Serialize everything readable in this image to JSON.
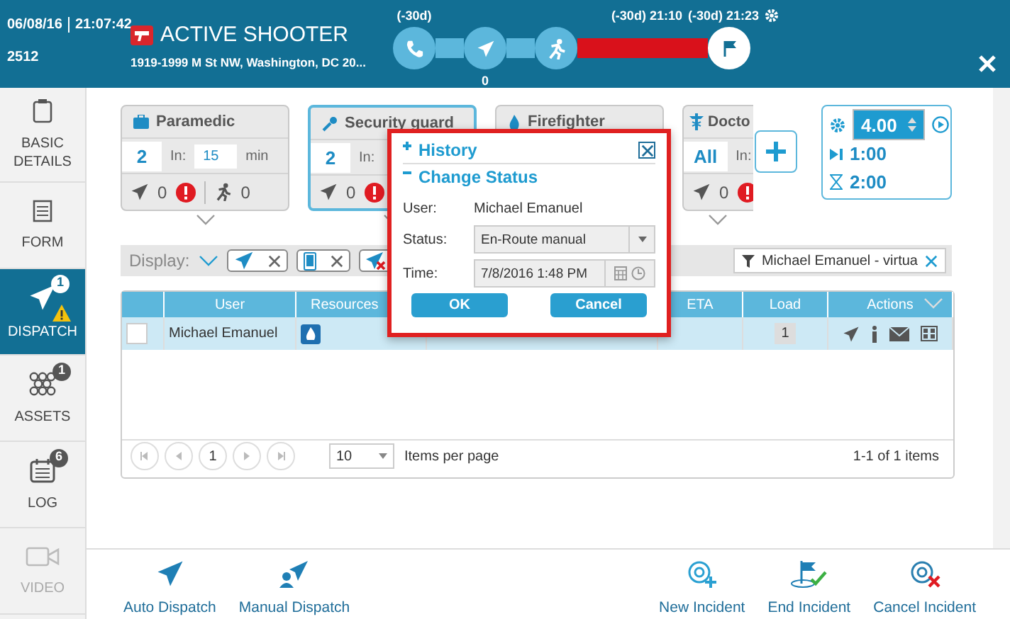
{
  "header": {
    "date": "06/08/16",
    "time": "21:07:42",
    "id": "2512",
    "title": "ACTIVE SHOOTER",
    "address": "1919-1999 M St NW, Washington, DC 20...",
    "timeline": {
      "start_label": "(-30d)",
      "dispatched_count": "0",
      "bar_label": "(-30d) 21:10",
      "end_label": "(-30d) 21:23"
    }
  },
  "sidebar": {
    "items": [
      {
        "label": "BASIC DETAILS",
        "selected": false,
        "disabled": false
      },
      {
        "label": "FORM",
        "selected": false,
        "disabled": false
      },
      {
        "label": "DISPATCH",
        "badge": "1",
        "warning": true,
        "selected": true,
        "disabled": false
      },
      {
        "label": "ASSETS",
        "badge": "1",
        "selected": false,
        "disabled": false
      },
      {
        "label": "LOG",
        "badge": "6",
        "selected": false,
        "disabled": false
      },
      {
        "label": "VIDEO",
        "selected": false,
        "disabled": true
      }
    ]
  },
  "cards": [
    {
      "title": "Paramedic",
      "count": "2",
      "in_label": "In:",
      "in_value": "15",
      "unit": "min",
      "dispatched": "0",
      "alert": true,
      "on_scene": "0",
      "selected": false
    },
    {
      "title": "Security guard",
      "count": "2",
      "in_label": "In:",
      "dispatched": "0",
      "alert": true,
      "selected": true
    },
    {
      "title": "Firefighter",
      "selected": false
    },
    {
      "title": "Docto",
      "count": "All",
      "in_label": "In:",
      "dispatched": "0",
      "alert": true,
      "selected": false
    }
  ],
  "timers": {
    "rate": "4.00",
    "step": "1:00",
    "duration": "2:00"
  },
  "display": {
    "label": "Display:",
    "chips": [
      {
        "kind": "dispatched"
      },
      {
        "kind": "device"
      },
      {
        "kind": "cancelled"
      }
    ]
  },
  "filter": {
    "value": "Michael Emanuel - virtua"
  },
  "table": {
    "columns": [
      "User",
      "Resources",
      "ETA",
      "Load",
      "Actions"
    ],
    "rows": [
      {
        "checked": false,
        "user": "Michael Emanuel",
        "load": "1"
      }
    ]
  },
  "pager": {
    "page": "1",
    "per_page": "10",
    "per_page_label": "Items per page",
    "summary": "1-1 of 1 items"
  },
  "toolbar": [
    {
      "label": "Auto Dispatch"
    },
    {
      "label": "Manual Dispatch"
    },
    {
      "label": "New Incident"
    },
    {
      "label": "End Incident"
    },
    {
      "label": "Cancel Incident"
    }
  ],
  "dialog": {
    "sections": [
      {
        "title": "History",
        "expanded": false
      },
      {
        "title": "Change Status",
        "expanded": true
      }
    ],
    "user_label": "User:",
    "user": "Michael Emanuel",
    "status_label": "Status:",
    "status": "En-Route manual",
    "time_label": "Time:",
    "time": "7/8/2016 1:48 PM",
    "buttons": [
      "OK",
      "Cancel"
    ]
  }
}
